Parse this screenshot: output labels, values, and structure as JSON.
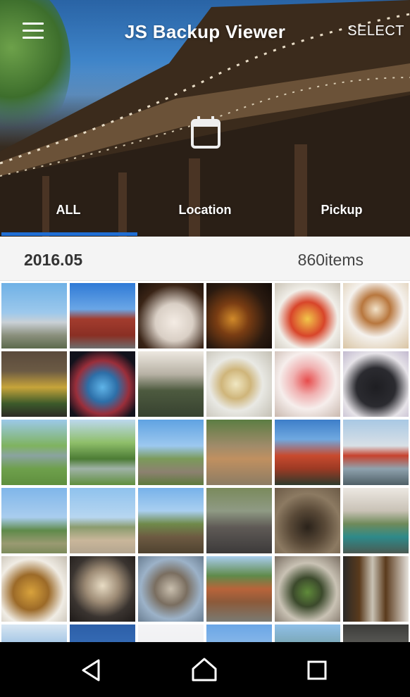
{
  "app": {
    "title": "JS Backup Viewer",
    "select_label": "SELECT"
  },
  "icons": {
    "menu": "hamburger-menu-icon",
    "calendar": "calendar-icon",
    "back": "back-triangle-icon",
    "home": "home-icon",
    "recent": "recent-apps-icon"
  },
  "tabs": [
    {
      "label": "ALL",
      "selected": true
    },
    {
      "label": "Location",
      "selected": false
    },
    {
      "label": "Pickup",
      "selected": false
    }
  ],
  "date_header": {
    "month": "2016.05",
    "count": "860items"
  },
  "colors": {
    "accent": "#1f6ed4",
    "navbar": "#000000",
    "strip": "#f4f4f4"
  },
  "photos": [
    "city-ferris-wheel",
    "red-brick-warehouse",
    "dessert-plate-candles",
    "beer-glass-bottle",
    "omelette-rice-plate",
    "latte-art-cup",
    "street-christmas-tree",
    "lit-christmas-tree",
    "stone-torii-garden",
    "ramen-bowl",
    "shaved-ice-dessert",
    "black-cat",
    "green-car-lawn",
    "car-trees",
    "fort-ruins-hill",
    "deer-park",
    "five-story-pagoda",
    "floating-torii-sea",
    "coastal-park",
    "woman-seaside",
    "brick-ruins",
    "stone-statue",
    "cave-shrine",
    "stone-steps",
    "grilled-fish-skewer",
    "oyster-grill",
    "oysters-plate",
    "wooden-building-trees",
    "restaurant-table",
    "orion-beer-bottles",
    "sea-horizon",
    "blue-sky",
    "white-sky",
    "clouds-sky",
    "sky-trees",
    "dark-rocks"
  ]
}
